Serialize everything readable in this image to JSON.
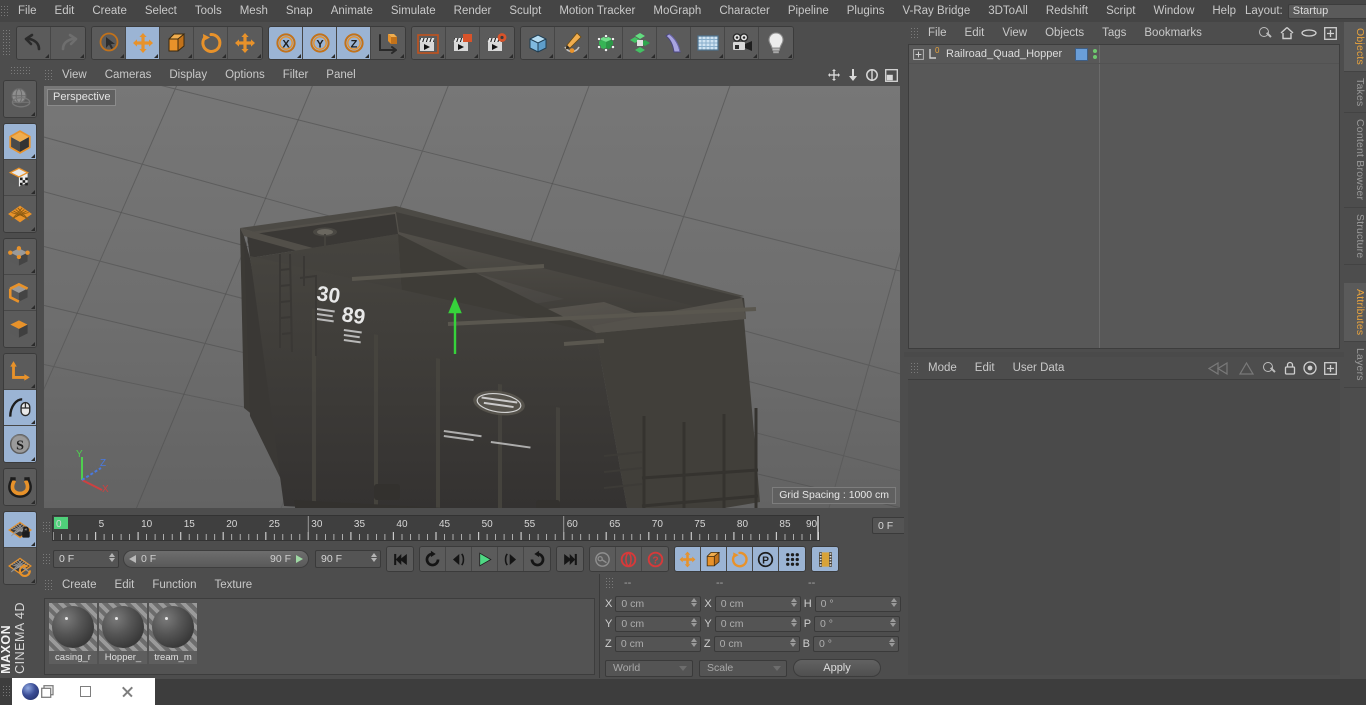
{
  "app": {
    "title": "CINEMA 4D",
    "brand": "MAXON"
  },
  "top_menu": {
    "items": [
      "File",
      "Edit",
      "Create",
      "Select",
      "Tools",
      "Mesh",
      "Snap",
      "Animate",
      "Simulate",
      "Render",
      "Sculpt",
      "Motion Tracker",
      "MoGraph",
      "Character",
      "Pipeline",
      "Plugins",
      "V-Ray Bridge",
      "3DToAll",
      "Redshift",
      "Script",
      "Window",
      "Help"
    ],
    "layout_label": "Layout:",
    "layout_value": "Startup",
    "search_icon": "search-icon"
  },
  "toolbar": {
    "groups": [
      {
        "name": "history",
        "buttons": [
          {
            "name": "undo-button",
            "icon": "undo-icon",
            "active": false
          },
          {
            "name": "redo-button",
            "icon": "redo-icon",
            "active": false
          }
        ]
      },
      {
        "name": "transform",
        "buttons": [
          {
            "name": "live-selection-button",
            "icon": "cursor-circle-icon",
            "active": false
          },
          {
            "name": "move-button",
            "icon": "move-arrows-icon",
            "active": true
          },
          {
            "name": "scale-button",
            "icon": "scale-box-icon",
            "active": false
          },
          {
            "name": "rotate-button",
            "icon": "rotate-circle-icon",
            "active": false
          },
          {
            "name": "dynamic-place-button",
            "icon": "move-arrows-icon",
            "active": false
          }
        ]
      },
      {
        "name": "axis-lock",
        "buttons": [
          {
            "name": "x-axis-button",
            "icon": "x-axis-icon",
            "active": true
          },
          {
            "name": "y-axis-button",
            "icon": "y-axis-icon",
            "active": true
          },
          {
            "name": "z-axis-button",
            "icon": "z-axis-icon",
            "active": true
          },
          {
            "name": "world-object-coord-button",
            "icon": "coordinate-cube-icon",
            "active": false
          }
        ]
      },
      {
        "name": "render",
        "buttons": [
          {
            "name": "render-view-button",
            "icon": "clapper-view-icon",
            "active": false
          },
          {
            "name": "render-region-button",
            "icon": "clapper-region-icon",
            "active": false
          },
          {
            "name": "render-settings-button",
            "icon": "clapper-gear-icon",
            "active": false
          }
        ]
      },
      {
        "name": "create",
        "buttons": [
          {
            "name": "add-cube-button",
            "icon": "blue-cube-icon",
            "active": false
          },
          {
            "name": "add-spline-button",
            "icon": "pen-spline-icon",
            "active": false
          },
          {
            "name": "add-nurbs-button",
            "icon": "green-cube-icon",
            "active": false
          },
          {
            "name": "add-array-button",
            "icon": "green-cluster-icon",
            "active": false
          },
          {
            "name": "add-deformer-button",
            "icon": "bend-deformer-icon",
            "active": false
          },
          {
            "name": "add-floor-button",
            "icon": "environment-grid-icon",
            "active": false
          },
          {
            "name": "add-camera-button",
            "icon": "camera-icon",
            "active": false
          },
          {
            "name": "add-light-button",
            "icon": "light-bulb-icon",
            "active": false
          }
        ]
      }
    ]
  },
  "left_toolbar": {
    "groups": [
      [
        {
          "name": "undo-view-button",
          "icon": "globe-sphere-icon",
          "active": false
        }
      ],
      [
        {
          "name": "model-mode-button",
          "icon": "model-cube-icon",
          "active": true
        },
        {
          "name": "texture-mode-button",
          "icon": "texture-cube-icon",
          "active": false
        },
        {
          "name": "workplane-mode-button",
          "icon": "workplane-grid-icon",
          "active": false
        }
      ],
      [
        {
          "name": "points-mode-button",
          "icon": "points-cube-icon",
          "active": false
        },
        {
          "name": "edges-mode-button",
          "icon": "edges-cube-icon",
          "active": false
        },
        {
          "name": "polygons-mode-button",
          "icon": "polygons-cube-icon",
          "active": false
        }
      ],
      [
        {
          "name": "axis-mode-button",
          "icon": "axis-arrow-icon",
          "active": false
        },
        {
          "name": "enable-snapping-button",
          "icon": "mouse-curve-icon",
          "active": true
        },
        {
          "name": "soft-selection-button",
          "icon": "s-sphere-icon",
          "active": true
        }
      ],
      [
        {
          "name": "magnet-button",
          "icon": "magnet-icon",
          "active": false
        }
      ],
      [
        {
          "name": "lock-workplane-button",
          "icon": "workplane-lock-icon",
          "active": true
        },
        {
          "name": "planar-workplane-button",
          "icon": "workplane-rotate-icon",
          "active": false
        }
      ]
    ]
  },
  "viewport": {
    "menu": [
      "View",
      "Cameras",
      "Display",
      "Options",
      "Filter",
      "Panel"
    ],
    "view_label": "Perspective",
    "grid_spacing": "Grid Spacing : 1000 cm",
    "axis_gizmo": {
      "x": "X",
      "y": "Y",
      "z": "Z",
      "x_color": "#cf4040",
      "y_color": "#4fcf4f",
      "z_color": "#4a7ae0"
    },
    "corner_icons": [
      "pan-icon",
      "dolly-icon",
      "rotate-icon",
      "maximize-icon"
    ],
    "model": {
      "name": "Railroad Quad Hopper",
      "number_left": "30",
      "number_right": "89"
    }
  },
  "timeline": {
    "ticks": [
      0,
      5,
      10,
      15,
      20,
      25,
      30,
      35,
      40,
      45,
      50,
      55,
      60,
      65,
      70,
      75,
      80,
      85,
      90
    ],
    "current_frame": "0 F",
    "playhead": 0
  },
  "animation_bar": {
    "current_frame_field": "0 F",
    "range_start": "0 F",
    "range_end": "90 F",
    "end_frame_field": "90 F",
    "buttons": [
      {
        "name": "goto-start-button",
        "icon": "skip-start-icon",
        "active": false
      },
      {
        "name": "previous-keyframe-button",
        "icon": "prev-key-icon",
        "active": false
      },
      {
        "name": "step-back-button",
        "icon": "step-back-icon",
        "active": false
      },
      {
        "name": "play-button",
        "icon": "play-icon",
        "active": false
      },
      {
        "name": "step-forward-button",
        "icon": "step-forward-icon",
        "active": false
      },
      {
        "name": "next-keyframe-button",
        "icon": "next-key-icon",
        "active": false
      },
      {
        "name": "goto-end-button",
        "icon": "skip-end-icon",
        "active": false
      },
      {
        "name": "record-active-objects-button",
        "icon": "key-icon",
        "active": false
      },
      {
        "name": "autokeying-button",
        "icon": "red-circle-icon",
        "active": false
      },
      {
        "name": "keyframe-selection-button",
        "icon": "red-question-icon",
        "active": false
      },
      {
        "name": "position-key-button",
        "icon": "move-arrows-icon",
        "active": true
      },
      {
        "name": "scale-key-button",
        "icon": "scale-box-icon",
        "active": true
      },
      {
        "name": "rotation-key-button",
        "icon": "rotate-circle-icon",
        "active": true
      },
      {
        "name": "parameter-key-button",
        "icon": "p-circle-icon",
        "active": true
      },
      {
        "name": "point-level-anim-button",
        "icon": "dots-grid-icon",
        "active": true
      },
      {
        "name": "timeline-button",
        "icon": "filmstrip-icon",
        "active": true
      }
    ]
  },
  "material_manager": {
    "menu": [
      "Create",
      "Edit",
      "Function",
      "Texture"
    ],
    "materials": [
      {
        "name": "casing_r"
      },
      {
        "name": "Hopper_"
      },
      {
        "name": "tream_m"
      }
    ]
  },
  "coordinates": {
    "headers": [
      "--",
      "--",
      "--"
    ],
    "rows": [
      {
        "pos_label": "X",
        "pos_value": "0 cm",
        "size_label": "X",
        "size_value": "0 cm",
        "rot_label": "H",
        "rot_value": "0 °"
      },
      {
        "pos_label": "Y",
        "pos_value": "0 cm",
        "size_label": "Y",
        "size_value": "0 cm",
        "rot_label": "P",
        "rot_value": "0 °"
      },
      {
        "pos_label": "Z",
        "pos_value": "0 cm",
        "size_label": "Z",
        "size_value": "0 cm",
        "rot_label": "B",
        "rot_value": "0 °"
      }
    ],
    "coord_system": "World",
    "mode": "Scale",
    "apply_label": "Apply"
  },
  "object_manager": {
    "menu": [
      "File",
      "Edit",
      "View",
      "Objects",
      "Tags",
      "Bookmarks"
    ],
    "icons": [
      "search-icon",
      "home-icon",
      "ellipse-icon",
      "plus-box-icon"
    ],
    "objects": [
      {
        "name": "Railroad_Quad_Hopper",
        "layer_badge": "0",
        "expandable": true
      }
    ]
  },
  "attribute_manager": {
    "menu": [
      "Mode",
      "Edit",
      "User Data"
    ],
    "icons": [
      "history-back-icon",
      "history-forward-icon",
      "search-icon",
      "lock-icon",
      "target-icon",
      "plus-box-icon"
    ]
  },
  "vertical_tabs": {
    "upper": [
      {
        "label": "Objects",
        "active": true
      },
      {
        "label": "Takes",
        "active": false
      },
      {
        "label": "Content Browser",
        "active": false
      },
      {
        "label": "Structure",
        "active": false
      }
    ],
    "lower": [
      {
        "label": "Attributes",
        "active": true
      },
      {
        "label": "Layers",
        "active": false
      }
    ]
  },
  "taskbar": {
    "app_icon": "cinema4d-logo-icon",
    "restore_icon": "restore-window-icon",
    "maximize_icon": "maximize-window-icon",
    "close_icon": "close-window-icon"
  }
}
